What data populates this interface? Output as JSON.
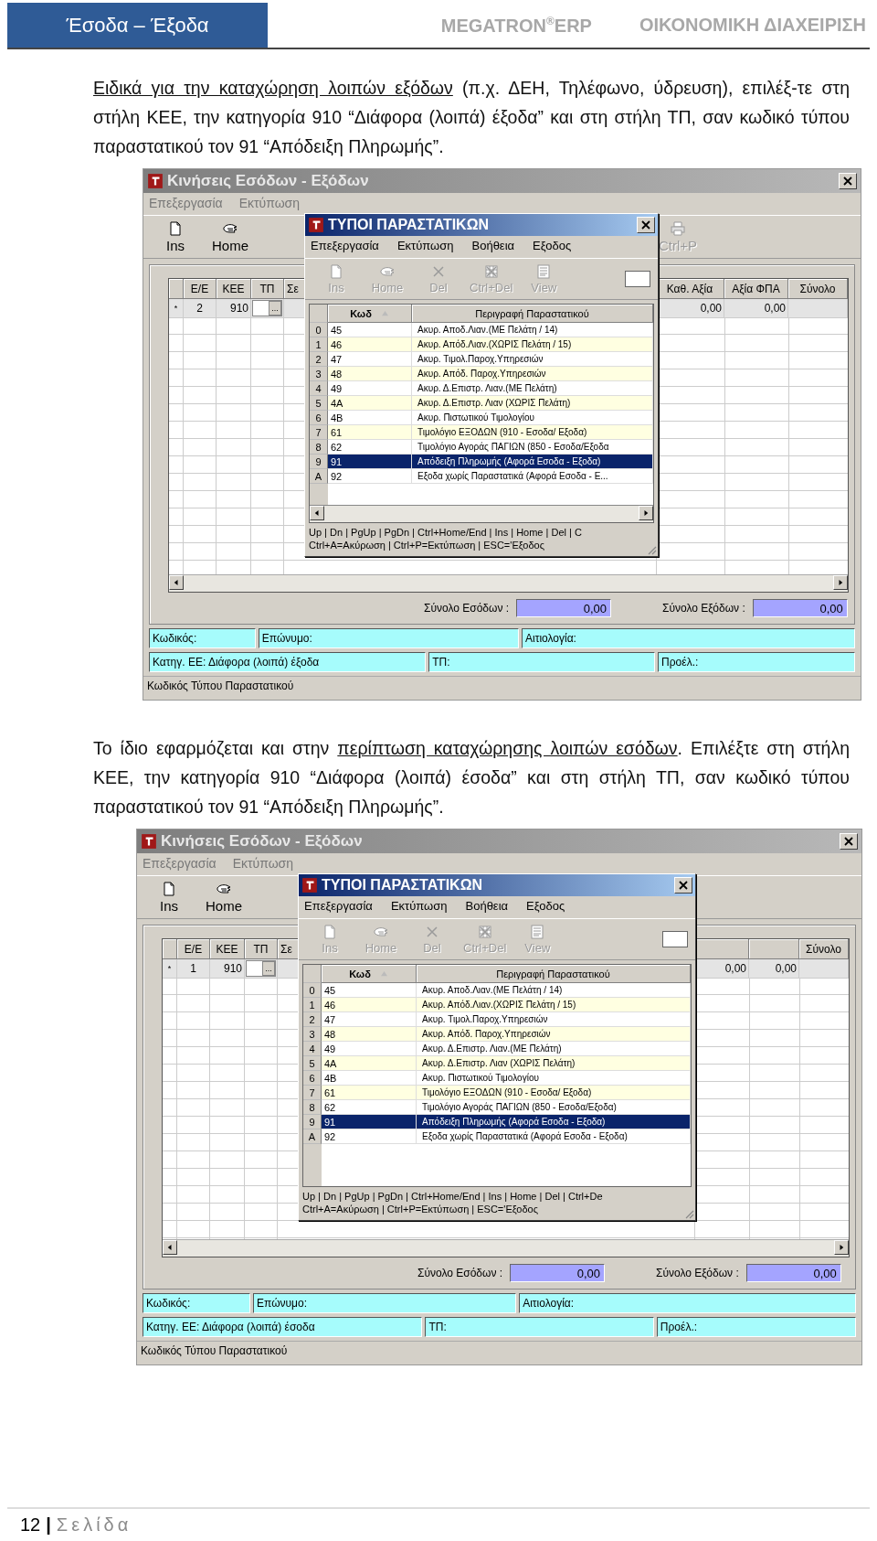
{
  "header": {
    "section_title": "Έσοδα – Έξοδα",
    "product": "MEGATRON$^{®}$ERP",
    "module": "ΟΙΚΟΝΟΜΙΚΗ ΔΙΑΧΕΙΡΙΣΗ"
  },
  "content": [
    {
      "kind": "paragraph",
      "parts": [
        {
          "text": "Ειδικά για την καταχώρηση λοιπών εξόδων",
          "underlined": true
        },
        {
          "text": " (π.χ. ΔΕΗ, Τηλέφωνο, ύδρευση), επιλέξ-τε στη στήλη ΚΕΕ, την κατηγορία 910 “Διάφορα (λοιπά) έξοδα” και στη στήλη ΤΠ, σαν κωδικό τύπου παραστατικού τον 91 “Απόδειξη Πληρωμής”.",
          "underlined": false
        }
      ]
    },
    {
      "kind": "screenshot",
      "window": {
        "title": "Κινήσεις Εσόδων - Εξόδων",
        "menu": [
          "Επεξεργασία",
          "Εκτύπωση"
        ],
        "toolbar": {
          "left": [
            {
              "label": "Ins",
              "kind": "new",
              "disabled": false
            },
            {
              "label": "Home",
              "kind": "home",
              "disabled": false
            }
          ],
          "right": [
            {
              "label": "Ctrl+P",
              "kind": "print",
              "disabled": true
            }
          ]
        },
        "grid": {
          "columns": [
            "Ε/Ε",
            "ΚΕΕ",
            "ΤΠ",
            "Σε"
          ],
          "right_columns": [
            {
              "header": "Καθ. Αξία",
              "value": "0,00"
            },
            {
              "header": "Αξία ΦΠΑ",
              "value": "0,00"
            },
            {
              "header": "Σύνολο"
            }
          ],
          "row": {
            "marker": "*",
            "entry": "2",
            "category": "910",
            "picker_button": "..."
          }
        },
        "totals": [
          {
            "label": "Σύνολο Εσόδων :",
            "value": "0,00"
          },
          {
            "label": "Σύνολο Εξόδων :",
            "value": "0,00"
          }
        ],
        "info_rows": [
          {
            "fields": [
              "Κωδικός:",
              "Επώνυμο:",
              "Αιτιολογία:"
            ]
          },
          {
            "fields": [
              "Κατηγ. ΕΕ: Διάφορα (λοιπά) έξοδα",
              "ΤΠ:",
              "Προέλ.:"
            ]
          }
        ],
        "status": "Κωδικός Τύπου Παραστατικού",
        "dialog": {
          "title": "ΤΥΠΟΙ ΠΑΡΑΣΤΑΤΙΚΩΝ",
          "menu": [
            "Επεξεργασία",
            "Εκτύπωση",
            "Βοήθεια",
            "Εξοδος"
          ],
          "toolbar": [
            {
              "label": "Ins",
              "kind": "new",
              "disabled": true
            },
            {
              "label": "Home",
              "kind": "home",
              "disabled": true
            },
            {
              "label": "Del",
              "kind": "delete",
              "disabled": true
            },
            {
              "label": "Ctrl+Del",
              "kind": "clear",
              "disabled": true
            },
            {
              "label": "View",
              "kind": "view",
              "disabled": true
            }
          ],
          "columns": [
            "Κωδ",
            "Περιγραφή Παραστατικού"
          ],
          "rows": [
            {
              "index": "0",
              "code": "45",
              "description": "Ακυρ. Αποδ.Λιαν.(ΜΕ Πελάτη / 14)",
              "selected": false
            },
            {
              "index": "1",
              "code": "46",
              "description": "Ακυρ. Απόδ.Λιαν.(ΧΩΡΙΣ Πελάτη / 15)",
              "selected": false
            },
            {
              "index": "2",
              "code": "47",
              "description": "Ακυρ. Τιμολ.Παροχ.Υπηρεσιών",
              "selected": false
            },
            {
              "index": "3",
              "code": "48",
              "description": "Ακυρ. Απόδ. Παροχ.Υπηρεσιών",
              "selected": false
            },
            {
              "index": "4",
              "code": "49",
              "description": "Ακυρ. Δ.Επιστρ. Λιαν.(ΜΕ Πελάτη)",
              "selected": false
            },
            {
              "index": "5",
              "code": "4A",
              "description": "Ακυρ. Δ.Επιστρ. Λιαν (ΧΩΡΙΣ Πελάτη)",
              "selected": false
            },
            {
              "index": "6",
              "code": "4B",
              "description": "Ακυρ. Πιστωτικού Τιμολογίου",
              "selected": false
            },
            {
              "index": "7",
              "code": "61",
              "description": "Τιμολόγιο ΕΞΟΔΩΝ (910 - Εσοδα/ Εξοδα)",
              "selected": false
            },
            {
              "index": "8",
              "code": "62",
              "description": "Τιμολόγιο Αγοράς ΠΑΓΙΩΝ (850 - Εσοδα/Εξοδα",
              "selected": false
            },
            {
              "index": "9",
              "code": "91",
              "description": "Απόδειξη Πληρωμής (Αφορά Εσοδα - Εξοδα)",
              "selected": true
            },
            {
              "index": "A",
              "code": "92",
              "description": "Εξοδα χωρίς Παραστατικά (Αφορά Εσοδα - Ε...",
              "selected": false
            }
          ],
          "hscroll": true,
          "status_lines": [
            "Up | Dn | PgUp | PgDn | Ctrl+Home/End | Ins | Home | Del | C",
            "Ctrl+A=Ακύρωση | Ctrl+P=Εκτύπωση | ESC='Εξοδος"
          ]
        }
      }
    },
    {
      "kind": "paragraph",
      "parts": [
        {
          "text": "Το ίδιο εφαρμόζεται και στην ",
          "underlined": false
        },
        {
          "text": "περίπτωση καταχώρησης λοιπών εσόδων",
          "underlined": true
        },
        {
          "text": ". Επιλέξτε στη στήλη ΚΕΕ, την κατηγορία 910 “Διάφορα (λοιπά) έσοδα” και στη στήλη ΤΠ, σαν κωδικό τύπου παραστατικού τον 91 “Απόδειξη Πληρωμής”.",
          "underlined": false
        }
      ]
    },
    {
      "kind": "screenshot",
      "window": {
        "title": "Κινήσεις Εσόδων - Εξόδων",
        "menu": [
          "Επεξεργασία",
          "Εκτύπωση"
        ],
        "toolbar": {
          "left": [
            {
              "label": "Ins",
              "kind": "new",
              "disabled": false
            },
            {
              "label": "Home",
              "kind": "home",
              "disabled": false
            }
          ]
        },
        "grid": {
          "columns": [
            "Ε/Ε",
            "ΚΕΕ",
            "ΤΠ",
            "Σε"
          ],
          "right_columns": [
            {
              "value": "0,00"
            },
            {
              "value": "0,00"
            },
            {
              "header": "Σύνολο"
            }
          ],
          "row": {
            "marker": "*",
            "entry": "1",
            "category": "910",
            "picker_button": "..."
          }
        },
        "totals": [
          {
            "label": "Σύνολο Εσόδων :",
            "value": "0,00"
          },
          {
            "label": "Σύνολο Εξόδων :",
            "value": "0,00"
          }
        ],
        "info_rows": [
          {
            "fields": [
              "Κωδικός:",
              "Επώνυμο:",
              "Αιτιολογία:"
            ]
          },
          {
            "fields": [
              "Κατηγ. ΕΕ: Διάφορα (λοιπά) έσοδα",
              "ΤΠ:",
              "Προέλ.:"
            ]
          }
        ],
        "status": "Κωδικός Τύπου Παραστατικού",
        "dialog": {
          "title": "ΤΥΠΟΙ ΠΑΡΑΣΤΑΤΙΚΩΝ",
          "menu": [
            "Επεξεργασία",
            "Εκτύπωση",
            "Βοήθεια",
            "Εξοδος"
          ],
          "toolbar": [
            {
              "label": "Ins",
              "kind": "new",
              "disabled": true
            },
            {
              "label": "Home",
              "kind": "home",
              "disabled": true
            },
            {
              "label": "Del",
              "kind": "delete",
              "disabled": true
            },
            {
              "label": "Ctrl+Del",
              "kind": "clear",
              "disabled": true
            },
            {
              "label": "View",
              "kind": "view",
              "disabled": true
            }
          ],
          "columns": [
            "Κωδ",
            "Περιγραφή Παραστατικού"
          ],
          "rows": [
            {
              "index": "0",
              "code": "45",
              "description": "Ακυρ. Αποδ.Λιαν.(ΜΕ Πελάτη / 14)",
              "selected": false
            },
            {
              "index": "1",
              "code": "46",
              "description": "Ακυρ. Απόδ.Λιαν.(ΧΩΡΙΣ Πελάτη / 15)",
              "selected": false
            },
            {
              "index": "2",
              "code": "47",
              "description": "Ακυρ. Τιμολ.Παροχ.Υπηρεσιών",
              "selected": false
            },
            {
              "index": "3",
              "code": "48",
              "description": "Ακυρ. Απόδ. Παροχ.Υπηρεσιών",
              "selected": false
            },
            {
              "index": "4",
              "code": "49",
              "description": "Ακυρ. Δ.Επιστρ. Λιαν.(ΜΕ Πελάτη)",
              "selected": false
            },
            {
              "index": "5",
              "code": "4A",
              "description": "Ακυρ. Δ.Επιστρ. Λιαν (ΧΩΡΙΣ Πελάτη)",
              "selected": false
            },
            {
              "index": "6",
              "code": "4B",
              "description": "Ακυρ. Πιστωτικού Τιμολογίου",
              "selected": false
            },
            {
              "index": "7",
              "code": "61",
              "description": "Τιμολόγιο ΕΞΟΔΩΝ (910 - Εσοδα/ Εξοδα)",
              "selected": false
            },
            {
              "index": "8",
              "code": "62",
              "description": "Τιμολόγιο Αγοράς ΠΑΓΙΩΝ (850 - Εσοδα/Εξοδα)",
              "selected": false
            },
            {
              "index": "9",
              "code": "91",
              "description": "Απόδειξη Πληρωμής (Αφορά Εσοδα - Εξοδα)",
              "selected": true
            },
            {
              "index": "A",
              "code": "92",
              "description": "Εξοδα χωρίς Παραστατικά (Αφορά Εσοδα - Εξοδα)",
              "selected": false
            }
          ],
          "hscroll": false,
          "status_lines": [
            "Up | Dn | PgUp | PgDn | Ctrl+Home/End | Ins | Home | Del | Ctrl+De",
            "Ctrl+A=Ακύρωση | Ctrl+P=Εκτύπωση | ESC='Εξοδος"
          ]
        }
      }
    }
  ],
  "footer": {
    "page_number": "12",
    "separator": "|",
    "label": "Σελίδα"
  }
}
